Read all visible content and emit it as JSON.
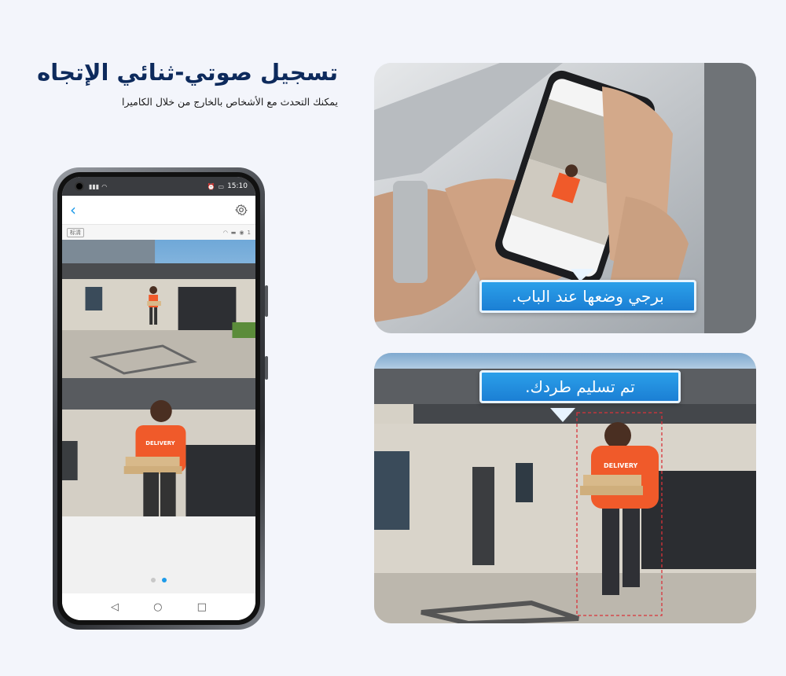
{
  "heading": {
    "title": "تسجيل صوتي-ثنائي الإتجاه",
    "subtitle": "يمكنك التحدث مع الأشخاص بالخارج من خلال الكاميرا"
  },
  "phone": {
    "status_time": "15:10",
    "quality_label": "标清",
    "viewer_count": "1",
    "pager_active_index": 1,
    "pager_count": 2
  },
  "card1": {
    "bubble_text": "برجي وضعها عند الباب."
  },
  "card2": {
    "bubble_text": "تم تسليم طردك."
  },
  "person": {
    "shirt_text": "DELIVERY"
  },
  "colors": {
    "title": "#0d2a5c",
    "accent": "#1e9be9",
    "bubble": "#1b7fd4",
    "shirt": "#f05a2a"
  }
}
